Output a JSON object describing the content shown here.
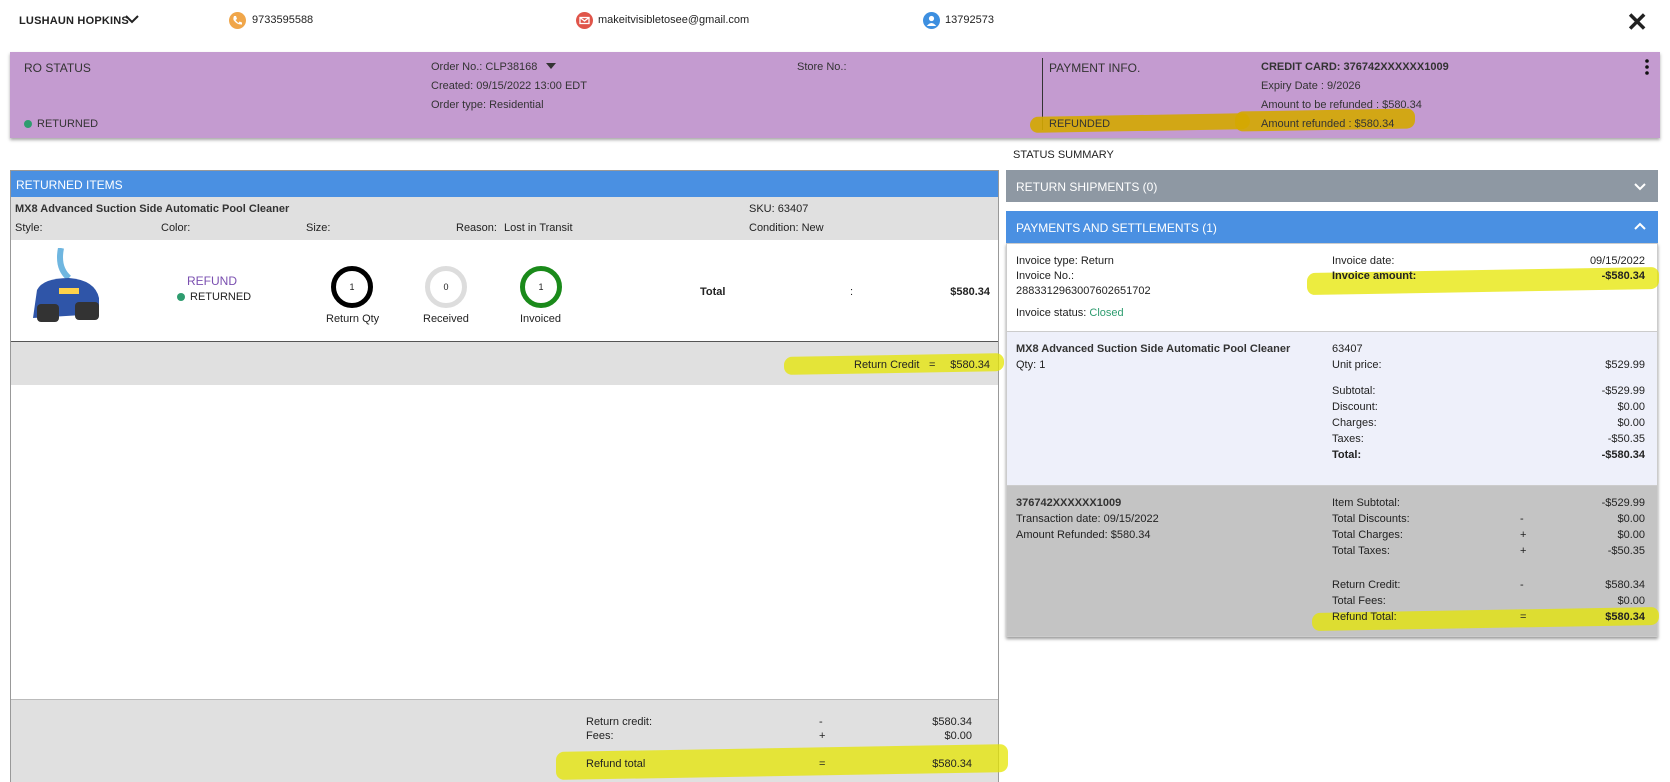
{
  "header": {
    "customer_name": "LUSHAUN HOPKINS",
    "phone": "9733595588",
    "email": "makeitvisibletosee@gmail.com",
    "account_id": "13792573",
    "close_symbol": "✕"
  },
  "ro_status": {
    "title": "RO STATUS",
    "status": "RETURNED",
    "order_no_label": "Order No.:",
    "order_no": "CLP38168",
    "created": "Created: 09/15/2022 13:00 EDT",
    "order_type_label": "Order type:",
    "order_type": "Residential",
    "store_no": "Store No.:"
  },
  "payment_info": {
    "title": "PAYMENT INFO.",
    "status": "REFUNDED",
    "credit_card": "CREDIT CARD: 376742XXXXXX1009",
    "expiry": "Expiry Date : 9/2026",
    "to_refund": "Amount to be refunded : $580.34",
    "refunded": "Amount refunded : $580.34"
  },
  "status_summary": "STATUS SUMMARY",
  "returned_items": {
    "title": "RETURNED ITEMS",
    "product": "MX8 Advanced Suction Side Automatic Pool Cleaner",
    "sku_label": "SKU:",
    "sku": "63407",
    "style_label": "Style:",
    "color_label": "Color:",
    "size_label": "Size:",
    "reason_label": "Reason:",
    "reason": "Lost in Transit",
    "condition_label": "Condition:",
    "condition": "New",
    "refund_label": "REFUND",
    "refund_status": "RETURNED",
    "return_qty": "1",
    "return_qty_label": "Return Qty",
    "received": "0",
    "received_label": "Received",
    "invoiced": "1",
    "invoiced_label": "Invoiced",
    "total_label": "Total",
    "total_colon": ":",
    "total": "$580.34",
    "return_credit_label": "Return Credit",
    "return_credit_eq": "=",
    "return_credit": "$580.34"
  },
  "footer": {
    "return_credit_label": "Return credit:",
    "return_credit_op": "-",
    "return_credit": "$580.34",
    "fees_label": "Fees:",
    "fees_op": "+",
    "fees": "$0.00",
    "refund_total_label": "Refund total",
    "refund_total_op": "=",
    "refund_total": "$580.34"
  },
  "return_shipments": "RETURN SHIPMENTS (0)",
  "payments_settlements": "PAYMENTS AND SETTLEMENTS (1)",
  "invoice": {
    "type_label": "Invoice type:",
    "type": "Return",
    "no_label": "Invoice No.:",
    "no": "2883312963007602651702",
    "status_label": "Invoice status:",
    "status": "Closed",
    "date_label": "Invoice date:",
    "date": "09/15/2022",
    "amount_label": "Invoice amount:",
    "amount": "-$580.34"
  },
  "invoice_item": {
    "product": "MX8 Advanced Suction Side Automatic Pool Cleaner",
    "qty_label": "Qty:",
    "qty": "1",
    "sku": "63407",
    "unit_price_label": "Unit price:",
    "unit_price": "$529.99",
    "subtotal_label": "Subtotal:",
    "subtotal": "-$529.99",
    "discount_label": "Discount:",
    "discount": "$0.00",
    "charges_label": "Charges:",
    "charges": "$0.00",
    "taxes_label": "Taxes:",
    "taxes": "-$50.35",
    "total_label": "Total:",
    "total": "-$580.34"
  },
  "transaction": {
    "card": "376742XXXXXX1009",
    "date": "Transaction date: 09/15/2022",
    "refunded": "Amount Refunded: $580.34",
    "item_subtotal_label": "Item Subtotal:",
    "item_subtotal": "-$529.99",
    "discounts_label": "Total Discounts:",
    "discounts_op": "-",
    "discounts": "$0.00",
    "charges_label": "Total Charges:",
    "charges_op": "+",
    "charges": "$0.00",
    "taxes_label": "Total Taxes:",
    "taxes_op": "+",
    "taxes": "-$50.35",
    "return_credit_label": "Return Credit:",
    "return_credit_op": "-",
    "return_credit": "$580.34",
    "fees_label": "Total Fees:",
    "fees": "$0.00",
    "refund_total_label": "Refund Total:",
    "refund_total_op": "=",
    "refund_total": "$580.34"
  },
  "colors": {
    "ro_bg": "#c49bd0",
    "accent_blue": "#4a90e2",
    "status_green": "#2e9c6f",
    "highlight_yellow": "#e6e600"
  },
  "icons": [
    "chevron-down-icon",
    "phone-icon",
    "email-icon",
    "user-icon",
    "close-icon",
    "more-vert-icon",
    "chevron-up-icon"
  ]
}
